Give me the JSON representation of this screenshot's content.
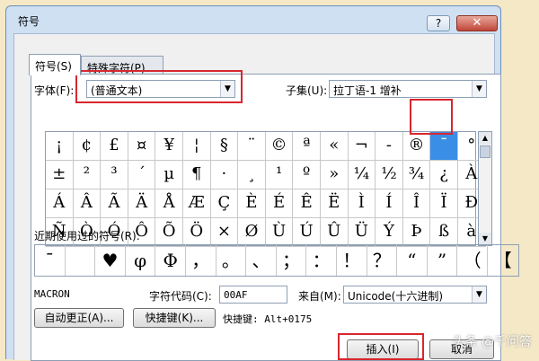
{
  "window": {
    "title": "符号",
    "help_label": "?",
    "close_label": "✕"
  },
  "tabs": [
    {
      "label": "符号(S)"
    },
    {
      "label": "特殊字符(P)"
    }
  ],
  "font": {
    "label": "字体(F):",
    "value": "(普通文本)"
  },
  "subset": {
    "label": "子集(U):",
    "value": "拉丁语-1 增补"
  },
  "symbols": [
    [
      "¡",
      "¢",
      "£",
      "¤",
      "¥",
      "¦",
      "§",
      "¨",
      "©",
      "ª",
      "«",
      "¬",
      "-",
      "®",
      "¯",
      "°"
    ],
    [
      "±",
      "²",
      "³",
      "´",
      "µ",
      "¶",
      "·",
      "¸",
      "¹",
      "º",
      "»",
      "¼",
      "½",
      "¾",
      "¿",
      "À"
    ],
    [
      "Á",
      "Â",
      "Ã",
      "Ä",
      "Å",
      "Æ",
      "Ç",
      "È",
      "É",
      "Ê",
      "Ë",
      "Ì",
      "Í",
      "Î",
      "Ï",
      "Ð"
    ],
    [
      "Ñ",
      "Ò",
      "Ó",
      "Ô",
      "Õ",
      "Ö",
      "×",
      "Ø",
      "Ù",
      "Ú",
      "Û",
      "Ü",
      "Ý",
      "Þ",
      "ß",
      "à"
    ]
  ],
  "selected_symbol": "¯",
  "recent": {
    "label": "近期使用过的符号(R):",
    "items": [
      "¯",
      "",
      "♥",
      "φ",
      "Φ",
      "，",
      "。",
      "、",
      "；",
      "：",
      "！",
      "？",
      "“",
      "”",
      "（",
      "【"
    ]
  },
  "char_name": "MACRON",
  "char_code": {
    "label": "字符代码(C):",
    "value": "00AF"
  },
  "from": {
    "label": "来自(M):",
    "value": "Unicode(十六进制)"
  },
  "buttons": {
    "autocorrect": "自动更正(A)...",
    "shortcut_key": "快捷键(K)...",
    "shortcut_text": "快捷键: Alt+0175",
    "insert": "插入(I)",
    "cancel": "取消"
  },
  "watermark": "头条 @千问答",
  "highlight_color": "#d8262f",
  "selection_color": "#3a8ee6"
}
